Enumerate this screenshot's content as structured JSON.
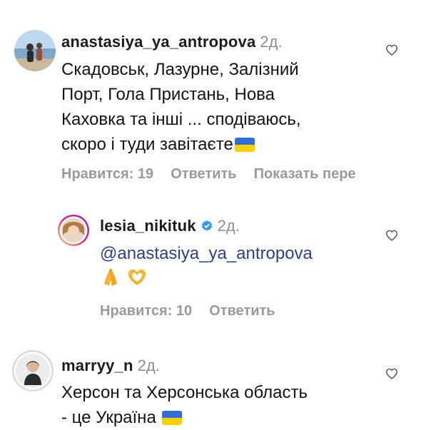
{
  "comments": [
    {
      "username": "anastasiya_ya_antropova",
      "time": "2д.",
      "lines": [
        "Скадовськ, Лазурне, Залізний",
        "Порт, Гола Пристань, Нова",
        "Каховка та інші ... сподіваюсь,",
        "скоро і туди завітаєте"
      ],
      "likes": "Нравится: 19",
      "reply": "Ответить",
      "translate": "Показать пере",
      "avatar_icon": "profile-photo-beach",
      "trailing_emoji": "ukraine-flag"
    },
    {
      "username": "lesia_nikituk",
      "verified": true,
      "time": "2д.",
      "mention": "@anastasiya_ya_antropova",
      "emoji_line": [
        "folded-hands",
        "heart-hands"
      ],
      "likes": "Нравится: 10",
      "reply": "Ответить",
      "avatar_icon": "profile-photo-story-ring"
    },
    {
      "username": "marryy_n",
      "time": "2д.",
      "lines": [
        "Херсон та Херсонська область",
        "- це Україна"
      ],
      "avatar_icon": "profile-photo-story-ring",
      "trailing_emoji": "ukraine-flag"
    }
  ],
  "colors": {
    "username": "#1c1c1c",
    "meta_gray": "#8e8e8e",
    "action_gray": "#9a9a9a",
    "mention_blue": "#2f3f86",
    "verified_blue": "#3897f0",
    "story_ring": [
      "#feda75",
      "#d62976",
      "#962fbf"
    ]
  },
  "icons": {
    "like": "heart-outline-icon",
    "verified": "verified-badge-icon"
  }
}
